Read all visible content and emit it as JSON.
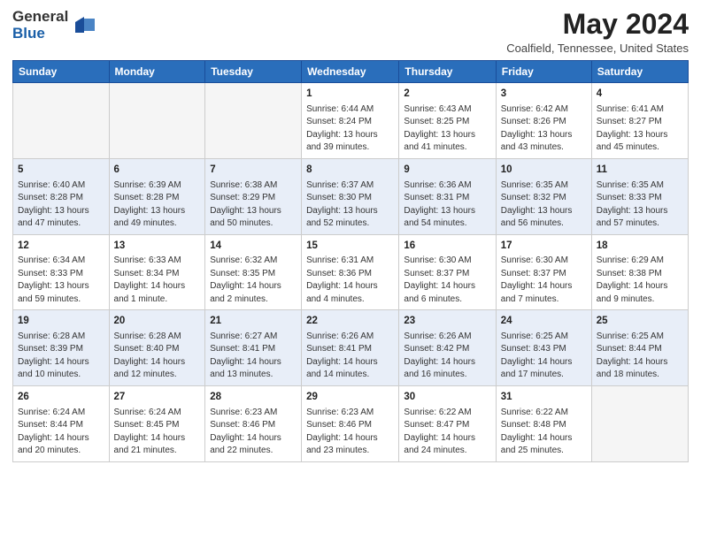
{
  "logo": {
    "general": "General",
    "blue": "Blue"
  },
  "title": {
    "month_year": "May 2024",
    "location": "Coalfield, Tennessee, United States"
  },
  "weekdays": [
    "Sunday",
    "Monday",
    "Tuesday",
    "Wednesday",
    "Thursday",
    "Friday",
    "Saturday"
  ],
  "weeks": [
    [
      {
        "day": "",
        "info": ""
      },
      {
        "day": "",
        "info": ""
      },
      {
        "day": "",
        "info": ""
      },
      {
        "day": "1",
        "info": "Sunrise: 6:44 AM\nSunset: 8:24 PM\nDaylight: 13 hours and 39 minutes."
      },
      {
        "day": "2",
        "info": "Sunrise: 6:43 AM\nSunset: 8:25 PM\nDaylight: 13 hours and 41 minutes."
      },
      {
        "day": "3",
        "info": "Sunrise: 6:42 AM\nSunset: 8:26 PM\nDaylight: 13 hours and 43 minutes."
      },
      {
        "day": "4",
        "info": "Sunrise: 6:41 AM\nSunset: 8:27 PM\nDaylight: 13 hours and 45 minutes."
      }
    ],
    [
      {
        "day": "5",
        "info": "Sunrise: 6:40 AM\nSunset: 8:28 PM\nDaylight: 13 hours and 47 minutes."
      },
      {
        "day": "6",
        "info": "Sunrise: 6:39 AM\nSunset: 8:28 PM\nDaylight: 13 hours and 49 minutes."
      },
      {
        "day": "7",
        "info": "Sunrise: 6:38 AM\nSunset: 8:29 PM\nDaylight: 13 hours and 50 minutes."
      },
      {
        "day": "8",
        "info": "Sunrise: 6:37 AM\nSunset: 8:30 PM\nDaylight: 13 hours and 52 minutes."
      },
      {
        "day": "9",
        "info": "Sunrise: 6:36 AM\nSunset: 8:31 PM\nDaylight: 13 hours and 54 minutes."
      },
      {
        "day": "10",
        "info": "Sunrise: 6:35 AM\nSunset: 8:32 PM\nDaylight: 13 hours and 56 minutes."
      },
      {
        "day": "11",
        "info": "Sunrise: 6:35 AM\nSunset: 8:33 PM\nDaylight: 13 hours and 57 minutes."
      }
    ],
    [
      {
        "day": "12",
        "info": "Sunrise: 6:34 AM\nSunset: 8:33 PM\nDaylight: 13 hours and 59 minutes."
      },
      {
        "day": "13",
        "info": "Sunrise: 6:33 AM\nSunset: 8:34 PM\nDaylight: 14 hours and 1 minute."
      },
      {
        "day": "14",
        "info": "Sunrise: 6:32 AM\nSunset: 8:35 PM\nDaylight: 14 hours and 2 minutes."
      },
      {
        "day": "15",
        "info": "Sunrise: 6:31 AM\nSunset: 8:36 PM\nDaylight: 14 hours and 4 minutes."
      },
      {
        "day": "16",
        "info": "Sunrise: 6:30 AM\nSunset: 8:37 PM\nDaylight: 14 hours and 6 minutes."
      },
      {
        "day": "17",
        "info": "Sunrise: 6:30 AM\nSunset: 8:37 PM\nDaylight: 14 hours and 7 minutes."
      },
      {
        "day": "18",
        "info": "Sunrise: 6:29 AM\nSunset: 8:38 PM\nDaylight: 14 hours and 9 minutes."
      }
    ],
    [
      {
        "day": "19",
        "info": "Sunrise: 6:28 AM\nSunset: 8:39 PM\nDaylight: 14 hours and 10 minutes."
      },
      {
        "day": "20",
        "info": "Sunrise: 6:28 AM\nSunset: 8:40 PM\nDaylight: 14 hours and 12 minutes."
      },
      {
        "day": "21",
        "info": "Sunrise: 6:27 AM\nSunset: 8:41 PM\nDaylight: 14 hours and 13 minutes."
      },
      {
        "day": "22",
        "info": "Sunrise: 6:26 AM\nSunset: 8:41 PM\nDaylight: 14 hours and 14 minutes."
      },
      {
        "day": "23",
        "info": "Sunrise: 6:26 AM\nSunset: 8:42 PM\nDaylight: 14 hours and 16 minutes."
      },
      {
        "day": "24",
        "info": "Sunrise: 6:25 AM\nSunset: 8:43 PM\nDaylight: 14 hours and 17 minutes."
      },
      {
        "day": "25",
        "info": "Sunrise: 6:25 AM\nSunset: 8:44 PM\nDaylight: 14 hours and 18 minutes."
      }
    ],
    [
      {
        "day": "26",
        "info": "Sunrise: 6:24 AM\nSunset: 8:44 PM\nDaylight: 14 hours and 20 minutes."
      },
      {
        "day": "27",
        "info": "Sunrise: 6:24 AM\nSunset: 8:45 PM\nDaylight: 14 hours and 21 minutes."
      },
      {
        "day": "28",
        "info": "Sunrise: 6:23 AM\nSunset: 8:46 PM\nDaylight: 14 hours and 22 minutes."
      },
      {
        "day": "29",
        "info": "Sunrise: 6:23 AM\nSunset: 8:46 PM\nDaylight: 14 hours and 23 minutes."
      },
      {
        "day": "30",
        "info": "Sunrise: 6:22 AM\nSunset: 8:47 PM\nDaylight: 14 hours and 24 minutes."
      },
      {
        "day": "31",
        "info": "Sunrise: 6:22 AM\nSunset: 8:48 PM\nDaylight: 14 hours and 25 minutes."
      },
      {
        "day": "",
        "info": ""
      }
    ]
  ],
  "row_classes": [
    "row-white",
    "row-blue",
    "row-white",
    "row-blue",
    "row-white"
  ]
}
